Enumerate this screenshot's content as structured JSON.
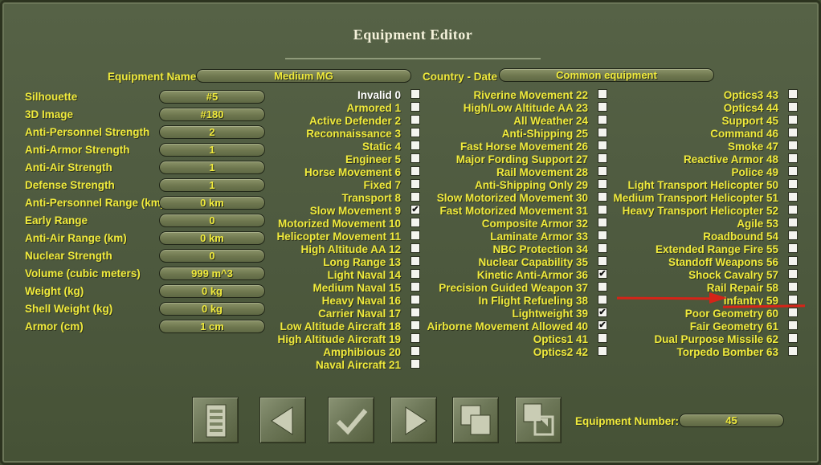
{
  "window": {
    "title": "Equipment Editor"
  },
  "header": {
    "name_label": "Equipment Name",
    "name_value": "Medium MG",
    "country_label": "Country - Date",
    "country_value": "Common equipment"
  },
  "fields": [
    {
      "label": "Silhouette",
      "value": "#5"
    },
    {
      "label": "3D Image",
      "value": "#180"
    },
    {
      "label": "Anti-Personnel Strength",
      "value": "2"
    },
    {
      "label": "Anti-Armor Strength",
      "value": "1"
    },
    {
      "label": "Anti-Air Strength",
      "value": "1"
    },
    {
      "label": "Defense Strength",
      "value": "1"
    },
    {
      "label": "Anti-Personnel Range (km)",
      "value": "0 km"
    },
    {
      "label": "Early Range",
      "value": "0"
    },
    {
      "label": "Anti-Air Range (km)",
      "value": "0 km"
    },
    {
      "label": "Nuclear Strength",
      "value": "0"
    },
    {
      "label": "Volume (cubic meters)",
      "value": "999 m^3"
    },
    {
      "label": "Weight (kg)",
      "value": "0 kg"
    },
    {
      "label": "Shell Weight (kg)",
      "value": "0 kg"
    },
    {
      "label": "Armor (cm)",
      "value": "1 cm"
    }
  ],
  "flag_columns": [
    [
      {
        "label": "Invalid 0",
        "checked": false,
        "highlight": true
      },
      {
        "label": "Armored 1",
        "checked": false
      },
      {
        "label": "Active Defender 2",
        "checked": false
      },
      {
        "label": "Reconnaissance 3",
        "checked": false
      },
      {
        "label": "Static 4",
        "checked": false
      },
      {
        "label": "Engineer 5",
        "checked": false
      },
      {
        "label": "Horse Movement 6",
        "checked": false
      },
      {
        "label": "Fixed 7",
        "checked": false
      },
      {
        "label": "Transport 8",
        "checked": false
      },
      {
        "label": "Slow Movement 9",
        "checked": true
      },
      {
        "label": "Motorized Movement 10",
        "checked": false
      },
      {
        "label": "Helicopter Movement 11",
        "checked": false
      },
      {
        "label": "High Altitude AA 12",
        "checked": false
      },
      {
        "label": "Long Range 13",
        "checked": false
      },
      {
        "label": "Light Naval 14",
        "checked": false
      },
      {
        "label": "Medium Naval 15",
        "checked": false
      },
      {
        "label": "Heavy Naval 16",
        "checked": false
      },
      {
        "label": "Carrier Naval 17",
        "checked": false
      },
      {
        "label": "Low Altitude Aircraft 18",
        "checked": false
      },
      {
        "label": "High Altitude Aircraft 19",
        "checked": false
      },
      {
        "label": "Amphibious 20",
        "checked": false
      },
      {
        "label": "Naval Aircraft 21",
        "checked": false
      }
    ],
    [
      {
        "label": "Riverine Movement 22",
        "checked": false
      },
      {
        "label": "High/Low Altitude AA 23",
        "checked": false
      },
      {
        "label": "All Weather 24",
        "checked": false
      },
      {
        "label": "Anti-Shipping 25",
        "checked": false
      },
      {
        "label": "Fast Horse Movement 26",
        "checked": false
      },
      {
        "label": "Major Fording Support 27",
        "checked": false
      },
      {
        "label": "Rail Movement 28",
        "checked": false
      },
      {
        "label": "Anti-Shipping Only 29",
        "checked": false
      },
      {
        "label": "Slow Motorized Movement 30",
        "checked": false
      },
      {
        "label": "Fast Motorized Movement 31",
        "checked": false
      },
      {
        "label": "Composite Armor 32",
        "checked": false
      },
      {
        "label": "Laminate Armor 33",
        "checked": false
      },
      {
        "label": "NBC Protection 34",
        "checked": false
      },
      {
        "label": "Nuclear Capability 35",
        "checked": false
      },
      {
        "label": "Kinetic Anti-Armor 36",
        "checked": true
      },
      {
        "label": "Precision Guided Weapon 37",
        "checked": false
      },
      {
        "label": "In Flight Refueling 38",
        "checked": false
      },
      {
        "label": "Lightweight 39",
        "checked": true
      },
      {
        "label": "Airborne Movement Allowed 40",
        "checked": true
      },
      {
        "label": "Optics1 41",
        "checked": false
      },
      {
        "label": "Optics2 42",
        "checked": false
      }
    ],
    [
      {
        "label": "Optics3 43",
        "checked": false
      },
      {
        "label": "Optics4 44",
        "checked": false
      },
      {
        "label": "Support 45",
        "checked": false
      },
      {
        "label": "Command 46",
        "checked": false
      },
      {
        "label": "Smoke 47",
        "checked": false
      },
      {
        "label": "Reactive Armor 48",
        "checked": false
      },
      {
        "label": "Police 49",
        "checked": false
      },
      {
        "label": "Light Transport Helicopter 50",
        "checked": false
      },
      {
        "label": "Medium Transport Helicopter 51",
        "checked": false
      },
      {
        "label": "Heavy Transport Helicopter 52",
        "checked": false
      },
      {
        "label": "Agile 53",
        "checked": false
      },
      {
        "label": "Roadbound 54",
        "checked": false
      },
      {
        "label": "Extended Range Fire 55",
        "checked": false
      },
      {
        "label": "Standoff Weapons 56",
        "checked": false
      },
      {
        "label": "Shock Cavalry 57",
        "checked": false
      },
      {
        "label": "Rail Repair 58",
        "checked": false
      },
      {
        "label": "Infantry 59",
        "checked": false
      },
      {
        "label": "Poor Geometry 60",
        "checked": false
      },
      {
        "label": "Fair Geometry 61",
        "checked": false
      },
      {
        "label": "Dual Purpose Missile 62",
        "checked": false
      },
      {
        "label": "Torpedo Bomber 63",
        "checked": false
      }
    ]
  ],
  "toolbar": [
    {
      "name": "list-button",
      "icon": "list-icon"
    },
    {
      "name": "previous-button",
      "icon": "arrow-left-icon"
    },
    {
      "name": "confirm-button",
      "icon": "checkmark-icon"
    },
    {
      "name": "next-button",
      "icon": "arrow-right-icon"
    },
    {
      "name": "copy-button",
      "icon": "copy-icon"
    },
    {
      "name": "paste-button",
      "icon": "paste-icon"
    }
  ],
  "footer": {
    "number_label": "Equipment Number:",
    "number_value": "45"
  },
  "annotation": {
    "color": "#d52418"
  },
  "colors": {
    "label": "#f0ea3c",
    "highlight": "#ffffff",
    "background": "#4e5a3f"
  }
}
